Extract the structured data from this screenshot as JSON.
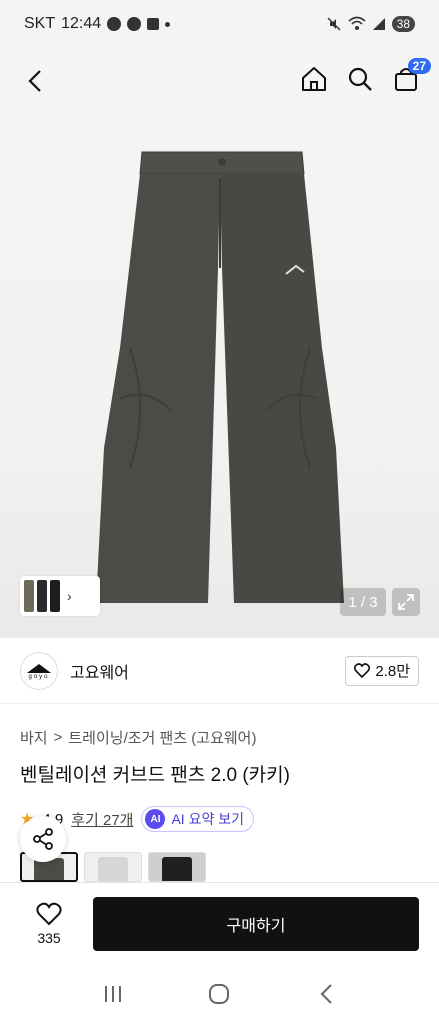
{
  "status_bar": {
    "carrier": "SKT",
    "time": "12:44",
    "battery": "38"
  },
  "header": {
    "cart_count": "27"
  },
  "gallery": {
    "page_counter": "1 / 3"
  },
  "brand": {
    "name": "고요웨어",
    "logo_text": "goyo",
    "like_count": "2.8만"
  },
  "breadcrumb": {
    "category": "바지",
    "separator": ">",
    "subcategory": "트레이닝/조거 팬츠 (고요웨어)"
  },
  "product": {
    "title": "벤틸레이션 커브드 팬츠 2.0 (카키)",
    "rating": "4.9",
    "reviews_label": "후기 27개",
    "ai_badge": "AI",
    "ai_summary_label": "AI 요약 보기"
  },
  "color_options": [
    {
      "name": "khaki",
      "color": "#4a4c46",
      "selected": true
    },
    {
      "name": "light-gray",
      "color": "#d6d6d4",
      "selected": false
    },
    {
      "name": "black",
      "color": "#202020",
      "selected": false
    }
  ],
  "bottom_bar": {
    "like_count": "335",
    "buy_label": "구매하기"
  },
  "colors": {
    "accent_blue": "#2e6cf6",
    "ai_purple": "#5b4cf0",
    "pants_khaki": "#4a4c46",
    "primary_button": "#111111"
  }
}
